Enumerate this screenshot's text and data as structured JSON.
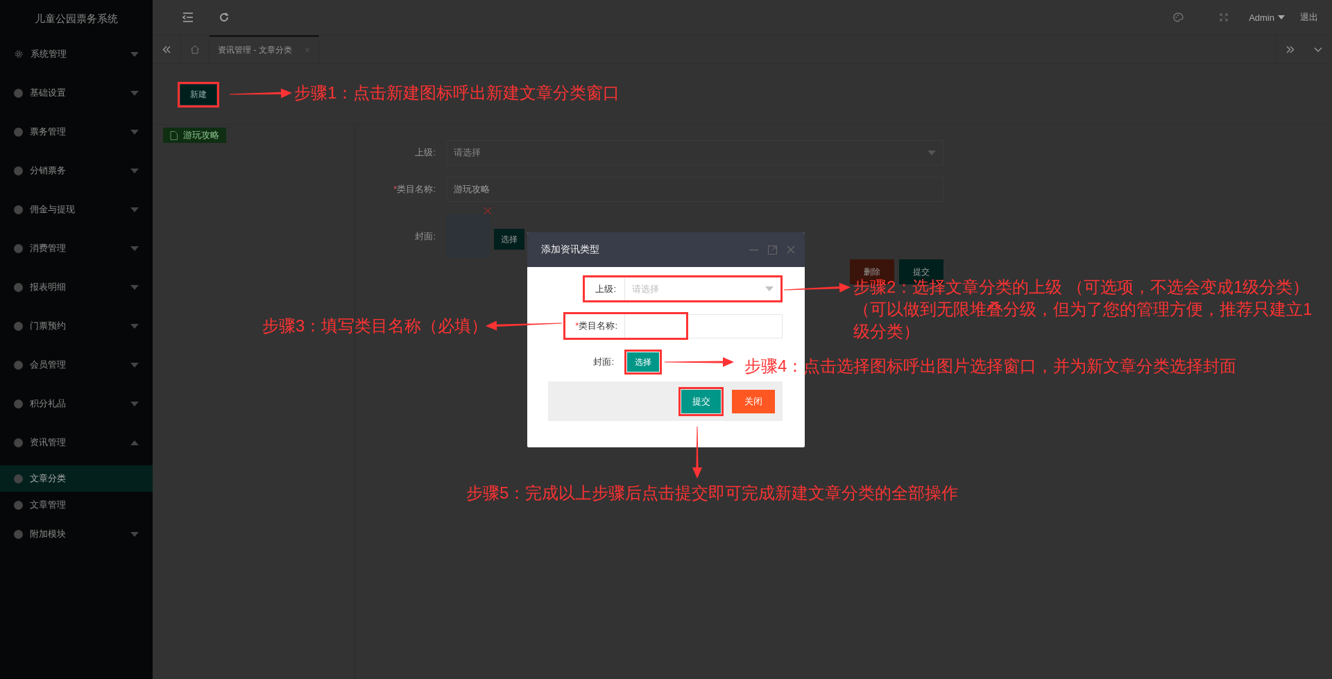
{
  "sidebar": {
    "title": "儿童公园票务系统",
    "items": [
      {
        "label": "系统管理",
        "kind": "gear",
        "expanded": false
      },
      {
        "label": "基础设置",
        "kind": "dot",
        "expanded": false
      },
      {
        "label": "票务管理",
        "kind": "dot",
        "expanded": false
      },
      {
        "label": "分销票务",
        "kind": "dot",
        "expanded": false
      },
      {
        "label": "佣金与提现",
        "kind": "dot",
        "expanded": false
      },
      {
        "label": "消费管理",
        "kind": "dot",
        "expanded": false
      },
      {
        "label": "报表明细",
        "kind": "dot",
        "expanded": false
      },
      {
        "label": "门票预约",
        "kind": "dot",
        "expanded": false
      },
      {
        "label": "会员管理",
        "kind": "dot",
        "expanded": false
      },
      {
        "label": "积分礼品",
        "kind": "dot",
        "expanded": false
      },
      {
        "label": "资讯管理",
        "kind": "dot",
        "expanded": true,
        "children": [
          {
            "label": "文章分类",
            "selected": true
          },
          {
            "label": "文章管理",
            "selected": false
          }
        ]
      },
      {
        "label": "附加模块",
        "kind": "dot",
        "expanded": false
      }
    ]
  },
  "topbar": {
    "user": "Admin",
    "logout": "退出"
  },
  "tabs": [
    {
      "label": "资讯管理 - 文章分类",
      "selected": true
    }
  ],
  "toolbar": {
    "new_button": "新建"
  },
  "tree": [
    {
      "label": "游玩攻略",
      "selected": true
    }
  ],
  "form": {
    "parent": {
      "label": "上级:",
      "placeholder": "请选择"
    },
    "name": {
      "required_mark": "*",
      "label": "类目名称:",
      "value": "游玩攻略"
    },
    "cover": {
      "label": "封面:",
      "button": "选择"
    },
    "buttons": [
      {
        "label": "删除",
        "kind": "danger"
      },
      {
        "label": "提交",
        "kind": "primary"
      }
    ]
  },
  "dialog": {
    "title": "添加资讯类型",
    "parent": {
      "label": "上级:",
      "placeholder": "请选择"
    },
    "name": {
      "required_mark": "*",
      "label": "类目名称:"
    },
    "cover": {
      "label": "封面:",
      "button": "选择"
    },
    "buttons": [
      {
        "label": "提交",
        "kind": "primary"
      },
      {
        "label": "关闭",
        "kind": "warning"
      }
    ]
  },
  "annotations": [
    {
      "text": "步骤1：点击新建图标呼出新建文章分类窗口"
    },
    {
      "text": "步骤3：填写类目名称（必填）"
    },
    {
      "text": "步骤2：选择文章分类的上级 （可选项，不选会变成1级分类）",
      "detail": "（可以做到无限堆叠分级，但为了您的管理方便，推荐只建立1级分类）"
    },
    {
      "text": "步骤4：点击选择图标呼出图片选择窗口，并为新文章分类选择封面"
    },
    {
      "text": "步骤5：完成以上步骤后点击提交即可完成新建文章分类的全部操作"
    }
  ]
}
